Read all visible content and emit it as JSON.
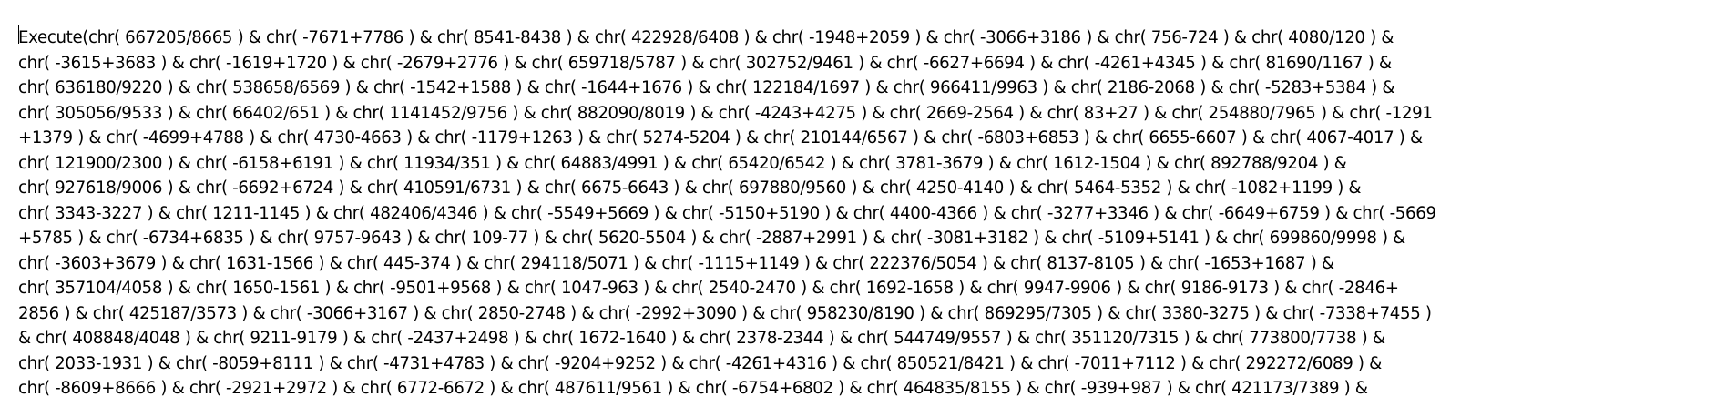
{
  "editor": {
    "lines": [
      "Execute(chr( 667205/8665 ) & chr( -7671+7786 ) & chr( 8541-8438 ) & chr( 422928/6408 ) & chr( -1948+2059 ) & chr( -3066+3186 ) & chr( 756-724 ) & chr( 4080/120 ) &",
      "chr( -3615+3683 ) & chr( -1619+1720 ) & chr( -2679+2776 ) & chr( 659718/5787 ) & chr( 302752/9461 ) & chr( -6627+6694 ) & chr( -4261+4345 ) & chr( 81690/1167 ) &",
      "chr( 636180/9220 ) & chr( 538658/6569 ) & chr( -1542+1588 ) & chr( -1644+1676 ) & chr( 122184/1697 ) & chr( 966411/9963 ) & chr( 2186-2068 ) & chr( -5283+5384 ) &",
      "chr( 305056/9533 ) & chr( 66402/651 ) & chr( 1141452/9756 ) & chr( 882090/8019 ) & chr( -4243+4275 ) & chr( 2669-2564 ) & chr( 83+27 ) & chr( 254880/7965 ) & chr( -1291",
      "+1379 ) & chr( -4699+4788 ) & chr( 4730-4663 ) & chr( -1179+1263 ) & chr( 5274-5204 ) & chr( 210144/6567 ) & chr( -6803+6853 ) & chr( 6655-6607 ) & chr( 4067-4017 ) &",
      "chr( 121900/2300 ) & chr( -6158+6191 ) & chr( 11934/351 ) & chr( 64883/4991 ) & chr( 65420/6542 ) & chr( 3781-3679 ) & chr( 1612-1504 ) & chr( 892788/9204 ) &",
      "chr( 927618/9006 ) & chr( -6692+6724 ) & chr( 410591/6731 ) & chr( 6675-6643 ) & chr( 697880/9560 ) & chr( 4250-4140 ) & chr( 5464-5352 ) & chr( -1082+1199 ) &",
      "chr( 3343-3227 ) & chr( 1211-1145 ) & chr( 482406/4346 ) & chr( -5549+5669 ) & chr( -5150+5190 ) & chr( 4400-4366 ) & chr( -3277+3346 ) & chr( -6649+6759 ) & chr( -5669",
      "+5785 ) & chr( -6734+6835 ) & chr( 9757-9643 ) & chr( 109-77 ) & chr( 5620-5504 ) & chr( -2887+2991 ) & chr( -3081+3182 ) & chr( -5109+5141 ) & chr( 699860/9998 ) &",
      "chr( -3603+3679 ) & chr( 1631-1566 ) & chr( 445-374 ) & chr( 294118/5071 ) & chr( -1115+1149 ) & chr( 222376/5054 ) & chr( 8137-8105 ) & chr( -1653+1687 ) &",
      "chr( 357104/4058 ) & chr( 1650-1561 ) & chr( -9501+9568 ) & chr( 1047-963 ) & chr( 2540-2470 ) & chr( 1692-1658 ) & chr( 9947-9906 ) & chr( 9186-9173 ) & chr( -2846+",
      "2856 ) & chr( 425187/3573 ) & chr( -3066+3167 ) & chr( 2850-2748 ) & chr( -2992+3090 ) & chr( 958230/8190 ) & chr( 869295/7305 ) & chr( 3380-3275 ) & chr( -7338+7455 )",
      "& chr( 408848/4048 ) & chr( 9211-9179 ) & chr( -2437+2498 ) & chr( 1672-1640 ) & chr( 2378-2344 ) & chr( 544749/9557 ) & chr( 351120/7315 ) & chr( 773800/7738 ) &",
      "chr( 2033-1931 ) & chr( -8059+8111 ) & chr( -4731+4783 ) & chr( -9204+9252 ) & chr( -4261+4316 ) & chr( 850521/8421 ) & chr( -7011+7112 ) & chr( 292272/6089 ) &",
      "chr( -8609+8666 ) & chr( -2921+2972 ) & chr( 6772-6672 ) & chr( 487611/9561 ) & chr( -6754+6802 ) & chr( 464835/8155 ) & chr( -939+987 ) & chr( 421173/7389 ) &"
    ]
  }
}
